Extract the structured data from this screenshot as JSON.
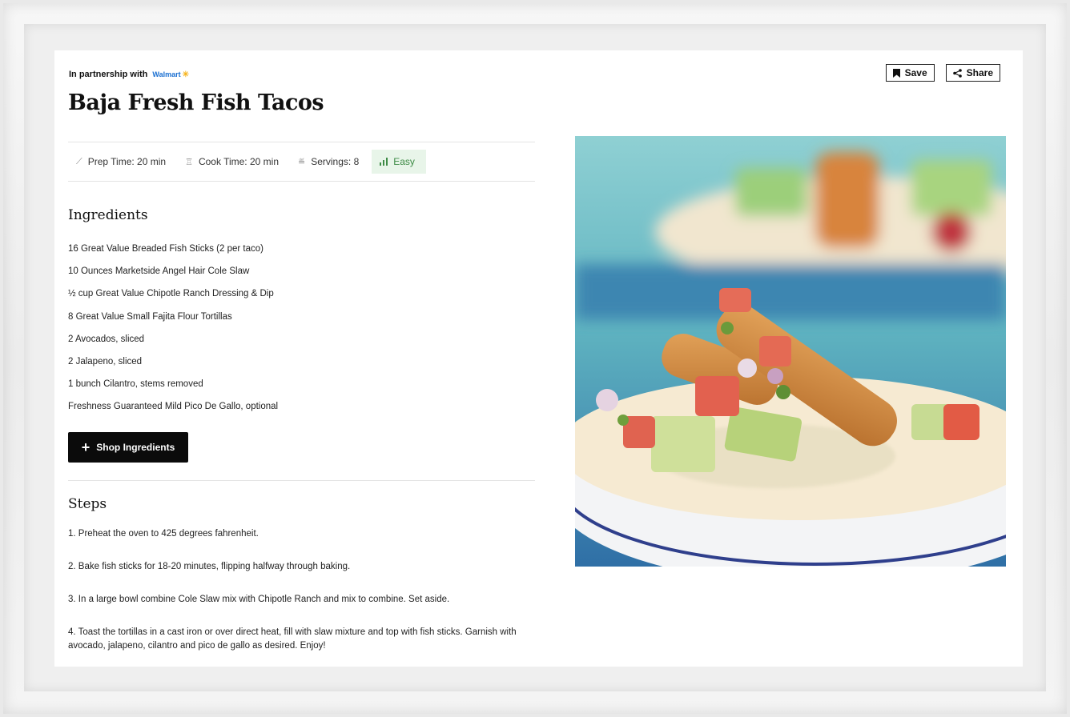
{
  "partner": {
    "label": "In partnership with",
    "brand": "Walmart"
  },
  "recipe_title": "Baja Fresh Fish Tacos",
  "actions": {
    "save_label": "Save",
    "share_label": "Share"
  },
  "meta": {
    "prep": "Prep Time: 20 min",
    "cook": "Cook Time: 20 min",
    "servings": "Servings: 8",
    "difficulty": "Easy"
  },
  "ingredients": {
    "heading": "Ingredients",
    "items": [
      "16 Great Value Breaded Fish Sticks (2 per taco)",
      "10 Ounces Marketside Angel Hair Cole Slaw",
      "½ cup Great Value Chipotle Ranch Dressing & Dip",
      "8 Great Value Small Fajita Flour Tortillas",
      "2 Avocados, sliced",
      "2 Jalapeno, sliced",
      "1 bunch Cilantro, stems removed",
      "Freshness Guaranteed Mild Pico De Gallo, optional"
    ],
    "shop_label": "Shop Ingredients"
  },
  "steps": {
    "heading": "Steps",
    "items": [
      "1. Preheat the oven to 425 degrees fahrenheit.",
      "2. Bake fish sticks for 18-20 minutes, flipping halfway through baking.",
      "3. In a large bowl combine Cole Slaw mix with Chipotle Ranch and mix to combine. Set aside.",
      "4. Toast the tortillas in a cast iron or over direct heat, fill with slaw mixture and top with fish sticks. Garnish with avocado, jalapeno, cilantro and pico de gallo as desired. Enjoy!"
    ]
  },
  "colors": {
    "difficulty_bg": "#e8f5e9",
    "difficulty_text": "#3d8b45",
    "walmart_blue": "#1a6fd1",
    "walmart_spark": "#f6b31b"
  }
}
